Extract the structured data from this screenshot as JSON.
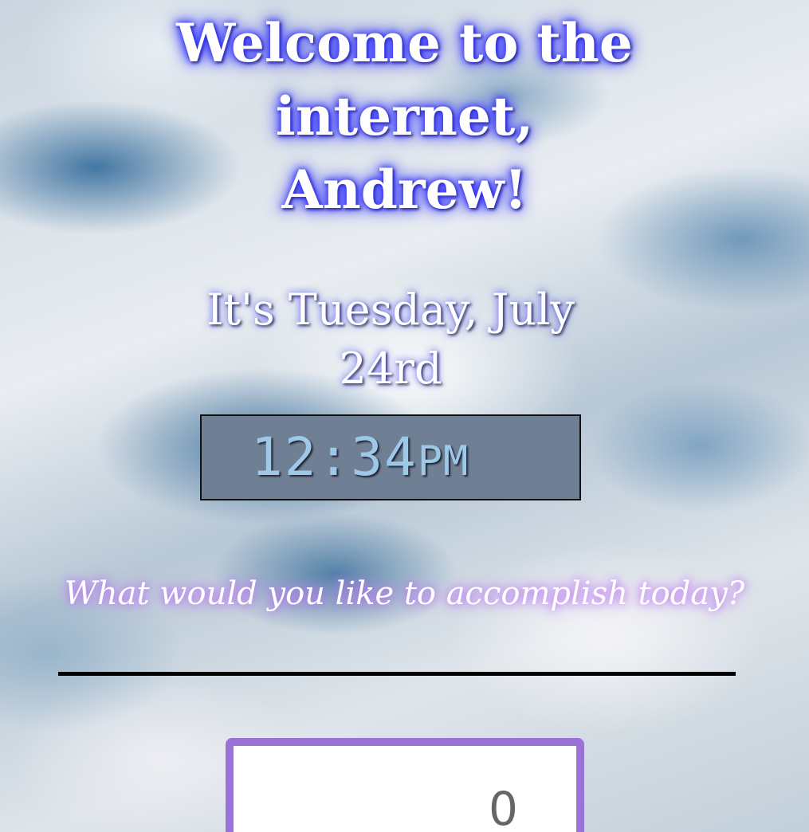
{
  "greeting": {
    "line1": "Welcome to the",
    "line2": "internet,",
    "line3": "Andrew!"
  },
  "date": {
    "line1": "It's Tuesday, July",
    "line2": "24rd"
  },
  "clock": {
    "time": "12:34",
    "ampm": "PM"
  },
  "prompt": {
    "question": "What would you like to accomplish today?",
    "input_value": ""
  },
  "counter": {
    "value": "0"
  },
  "colors": {
    "greeting_glow": "#3b3bff",
    "clock_bg": "#6f8094",
    "clock_text": "#9ec8e8",
    "question_glow": "#b46ef0",
    "counter_border": "#9a72d8"
  }
}
